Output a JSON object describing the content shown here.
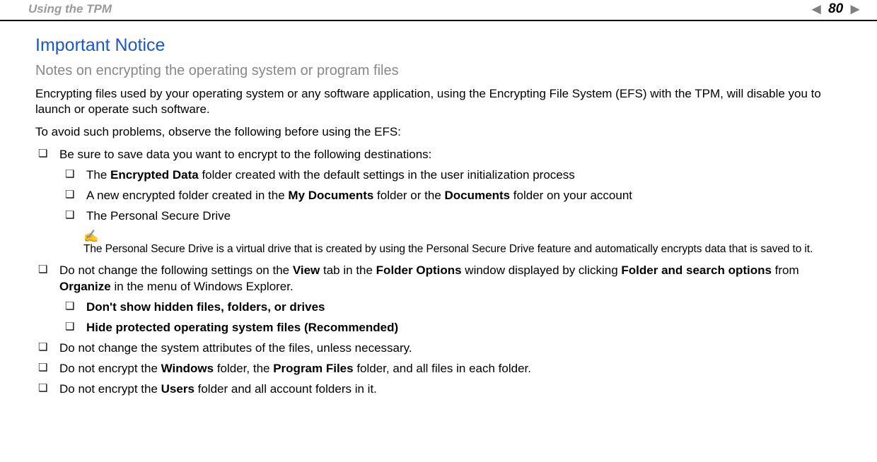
{
  "header": {
    "breadcrumb": "Using the TPM",
    "page_number": "80",
    "nav_n": "n",
    "nav_N": "N"
  },
  "content": {
    "title": "Important Notice",
    "subtitle": "Notes on encrypting the operating system or program files",
    "para1": "Encrypting files used by your operating system or any software application, using the Encrypting File System (EFS) with the TPM, will disable you to launch or operate such software.",
    "para2": "To avoid such problems, observe the following before using the EFS:",
    "b1": "Be sure to save data you want to encrypt to the following destinations:",
    "b1a_pre": "The ",
    "b1a_bold": "Encrypted Data",
    "b1a_post": " folder created with the default settings in the user initialization process",
    "b1b_pre": "A new encrypted folder created in the ",
    "b1b_bold1": "My Documents",
    "b1b_mid": " folder or the ",
    "b1b_bold2": "Documents",
    "b1b_post": " folder on your account",
    "b1c": "The Personal Secure Drive",
    "note_icon": "✍",
    "note": "The Personal Secure Drive is a virtual drive that is created by using the Personal Secure Drive feature and automatically encrypts data that is saved to it.",
    "b2_pre": "Do not change the following settings on the ",
    "b2_bold1": "View",
    "b2_mid1": " tab in the ",
    "b2_bold2": "Folder Options",
    "b2_mid2": " window displayed by clicking ",
    "b2_bold3": "Folder and search options",
    "b2_mid3": " from ",
    "b2_bold4": "Organize",
    "b2_post": " in the menu of Windows Explorer.",
    "b2a": "Don't show hidden files, folders, or drives",
    "b2b": "Hide protected operating system files (Recommended)",
    "b3": "Do not change the system attributes of the files, unless necessary.",
    "b4_pre": "Do not encrypt the ",
    "b4_bold1": "Windows",
    "b4_mid1": " folder, the ",
    "b4_bold2": "Program Files",
    "b4_post": " folder, and all files in each folder.",
    "b5_pre": "Do not encrypt the ",
    "b5_bold1": "Users",
    "b5_post": " folder and all account folders in it."
  }
}
